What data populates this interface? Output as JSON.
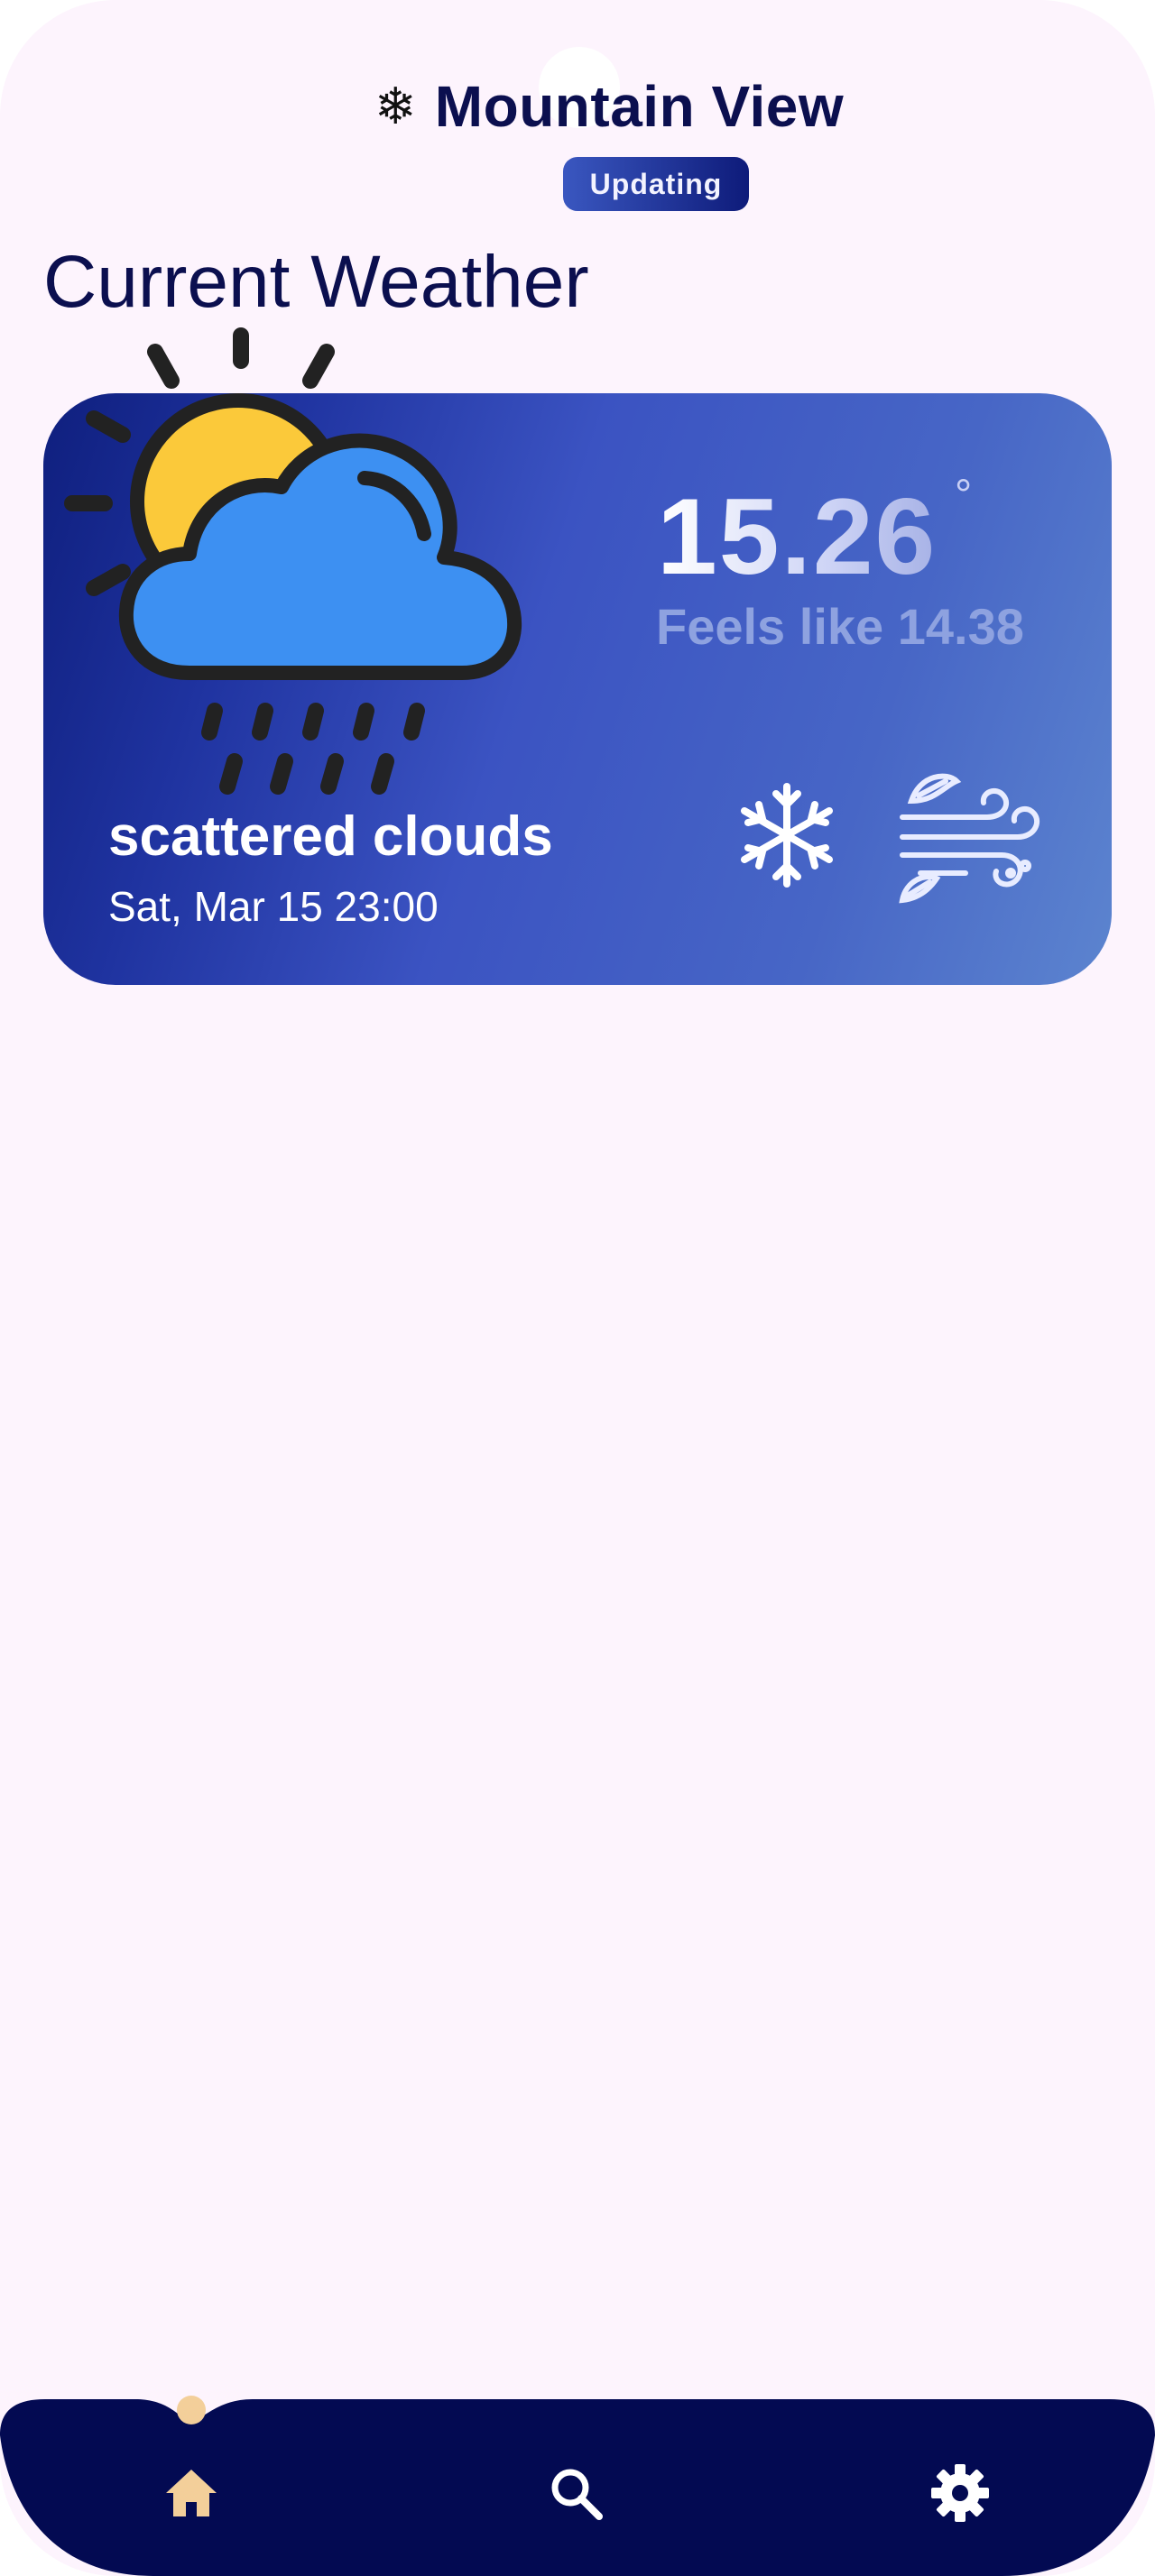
{
  "header": {
    "snow_icon": "❄",
    "city": "Mountain View",
    "status_badge": "Updating"
  },
  "section": {
    "title": "Current Weather"
  },
  "current": {
    "temperature": "15.26",
    "degree_symbol": "°",
    "feels_like": "Feels like 14.38",
    "condition": "scattered clouds",
    "datetime": "Sat, Mar 15 23:00",
    "icons": [
      "weather-rain-sun-icon",
      "snowflake-icon",
      "wind-icon"
    ]
  },
  "nav": {
    "items": [
      {
        "name": "home",
        "icon": "home-icon",
        "active": true
      },
      {
        "name": "search",
        "icon": "search-icon",
        "active": false
      },
      {
        "name": "settings",
        "icon": "gear-icon",
        "active": false
      }
    ]
  },
  "colors": {
    "background": "#fdf4fd",
    "title": "#0b0f4f",
    "card_start": "#0f1f7e",
    "card_end": "#5c84cf",
    "nav_bg": "#030a52",
    "nav_active": "#f3cf9a"
  }
}
